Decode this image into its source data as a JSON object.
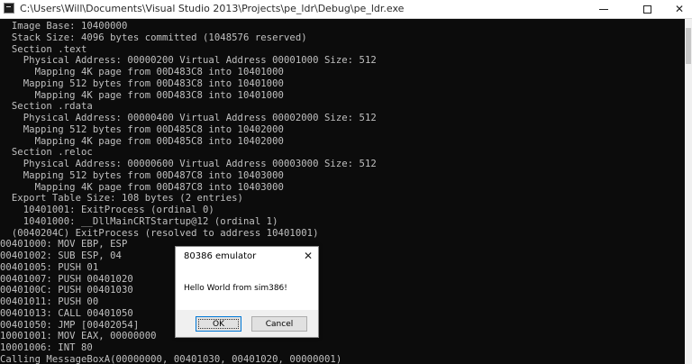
{
  "window": {
    "title": "C:\\Users\\Will\\Documents\\Visual Studio 2013\\Projects\\pe_ldr\\Debug\\pe_ldr.exe",
    "minimize_glyph": "—",
    "maximize_glyph": "☐",
    "close_glyph": "✕"
  },
  "console": {
    "lines": [
      "  Image Base: 10400000",
      "  Stack Size: 4096 bytes committed (1048576 reserved)",
      "  Section .text",
      "    Physical Address: 00000200 Virtual Address 00001000 Size: 512",
      "      Mapping 4K page from 00D483C8 into 10401000",
      "    Mapping 512 bytes from 00D483C8 into 10401000",
      "      Mapping 4K page from 00D483C8 into 10401000",
      "  Section .rdata",
      "    Physical Address: 00000400 Virtual Address 00002000 Size: 512",
      "    Mapping 512 bytes from 00D485C8 into 10402000",
      "      Mapping 4K page from 00D485C8 into 10402000",
      "  Section .reloc",
      "    Physical Address: 00000600 Virtual Address 00003000 Size: 512",
      "    Mapping 512 bytes from 00D487C8 into 10403000",
      "      Mapping 4K page from 00D487C8 into 10403000",
      "  Export Table Size: 108 bytes (2 entries)",
      "    10401001: ExitProcess (ordinal 0)",
      "    10401000: __DllMainCRTStartup@12 (ordinal 1)",
      "  (0040204C) ExitProcess (resolved to address 10401001)",
      "00401000: MOV EBP, ESP",
      "00401002: SUB ESP, 04",
      "00401005: PUSH 01",
      "00401007: PUSH 00401020",
      "0040100C: PUSH 00401030",
      "00401011: PUSH 00",
      "00401013: CALL 00401050",
      "00401050: JMP [00402054]",
      "10001001: MOV EAX, 00000000",
      "10001006: INT 80",
      "Calling MessageBoxA(00000000, 00401030, 00401020, 00000001)"
    ]
  },
  "dialog": {
    "title": "80386 emulator",
    "message": "Hello World from sim386!",
    "ok_label": "OK",
    "cancel_label": "Cancel",
    "close_glyph": "✕"
  }
}
